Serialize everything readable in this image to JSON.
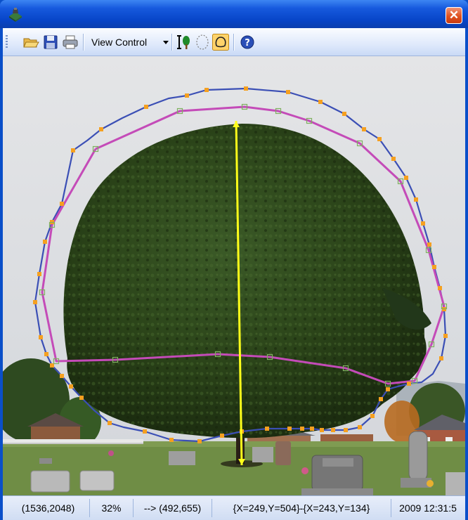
{
  "toolbar": {
    "view_control_label": "View Control",
    "icons": [
      "open-folder-icon",
      "save-icon",
      "print-icon",
      "tree-height-icon",
      "ellipse-tool-icon",
      "polygon-tool-icon",
      "help-icon"
    ]
  },
  "window": {
    "close_glyph": "✕"
  },
  "colors": {
    "outer_outline": "#3b4fb5",
    "inner_outline": "#c44bb8",
    "vertex_marker": "#f5a020",
    "height_line": "#ffff1a"
  },
  "status": {
    "image_size": "(1536,2048)",
    "zoom": "32%",
    "cursor_position": "--> (492,655)",
    "height_line_endpoints": "{X=249,Y=504}-{X=243,Y=134}",
    "date_time": "2009 12:31:5"
  }
}
